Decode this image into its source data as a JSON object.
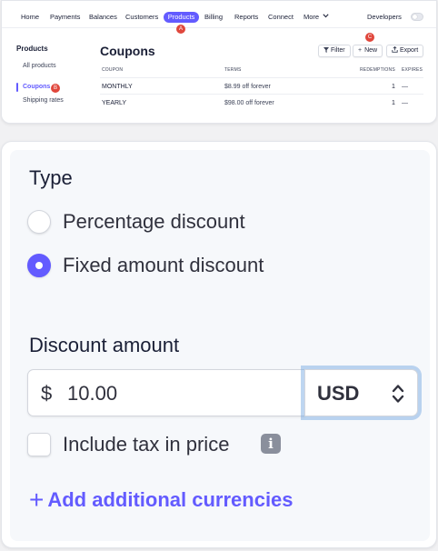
{
  "nav": {
    "items": [
      "Home",
      "Payments",
      "Balances",
      "Customers"
    ],
    "active": "Products",
    "items_after": [
      "Billing",
      "Reports",
      "Connect"
    ],
    "more": "More",
    "developers": "Developers"
  },
  "badges": {
    "a": "A",
    "b": "B",
    "c": "C"
  },
  "sidebar": {
    "title": "Products",
    "items": [
      "All products",
      "Coupons",
      "Shipping rates"
    ]
  },
  "page": {
    "title": "Coupons",
    "buttons": {
      "filter": "Filter",
      "new": "New",
      "export": "Export"
    },
    "columns": [
      "Coupon",
      "Terms",
      "Redemptions",
      "Expires"
    ],
    "rows": [
      {
        "coupon": "MONTHLY",
        "terms": "$8.99 off forever",
        "redemptions": "1",
        "expires": "—"
      },
      {
        "coupon": "YEARLY",
        "terms": "$98.00 off forever",
        "redemptions": "1",
        "expires": "—"
      }
    ]
  },
  "form": {
    "type_heading": "Type",
    "options": [
      "Percentage discount",
      "Fixed amount discount"
    ],
    "selected_option": "Fixed amount discount",
    "amount_heading": "Discount amount",
    "currency_symbol": "$",
    "amount": "10.00",
    "currency": "USD",
    "include_tax_label": "Include tax in price",
    "include_tax_checked": false,
    "info_icon": "i",
    "add_currencies": "Add additional currencies"
  },
  "colors": {
    "accent": "#635bff",
    "badge": "#e0473c",
    "focus_ring": "#6fa4e0"
  }
}
